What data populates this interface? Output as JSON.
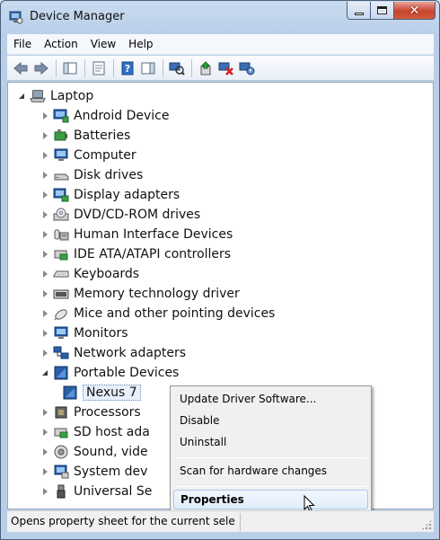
{
  "window": {
    "title": "Device Manager"
  },
  "menubar": {
    "items": [
      "File",
      "Action",
      "View",
      "Help"
    ]
  },
  "toolbar": {
    "buttons": [
      "back-arrow-icon",
      "forward-arrow-icon",
      "show-hide-tree-icon",
      "properties-icon",
      "help-icon",
      "action-pane-icon",
      "scan-hardware-icon",
      "update-driver-icon",
      "uninstall-icon",
      "enable-device-icon"
    ]
  },
  "tree": {
    "root": "Laptop",
    "nodes": [
      {
        "label": "Android Device",
        "expanded": false
      },
      {
        "label": "Batteries",
        "expanded": false
      },
      {
        "label": "Computer",
        "expanded": false
      },
      {
        "label": "Disk drives",
        "expanded": false
      },
      {
        "label": "Display adapters",
        "expanded": false
      },
      {
        "label": "DVD/CD-ROM drives",
        "expanded": false
      },
      {
        "label": "Human Interface Devices",
        "expanded": false
      },
      {
        "label": "IDE ATA/ATAPI controllers",
        "expanded": false
      },
      {
        "label": "Keyboards",
        "expanded": false
      },
      {
        "label": "Memory technology driver",
        "expanded": false
      },
      {
        "label": "Mice and other pointing devices",
        "expanded": false
      },
      {
        "label": "Monitors",
        "expanded": false
      },
      {
        "label": "Network adapters",
        "expanded": false
      },
      {
        "label": "Portable Devices",
        "expanded": true
      },
      {
        "label": "Nexus 7",
        "child": true
      },
      {
        "label": "Processors",
        "expanded": false
      },
      {
        "label": "SD host ada",
        "expanded": false
      },
      {
        "label": "Sound, vide",
        "expanded": false
      },
      {
        "label": "System dev",
        "expanded": false
      },
      {
        "label": "Universal Se",
        "expanded": false
      }
    ]
  },
  "context_menu": {
    "items": [
      "Update Driver Software...",
      "Disable",
      "Uninstall",
      "Scan for hardware changes",
      "Properties"
    ],
    "highlighted": "Properties"
  },
  "statusbar": {
    "text": "Opens property sheet for the current selec"
  },
  "colors": {
    "selection": "#e7f0fb",
    "menu_hover_border": "#a8c8ec",
    "close_button": "#c7442d"
  }
}
